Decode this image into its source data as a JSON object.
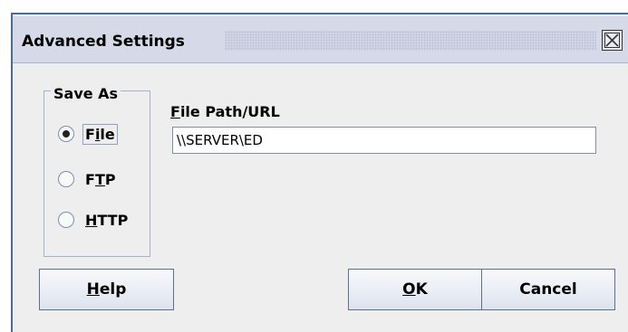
{
  "dialog": {
    "title": "Advanced Settings"
  },
  "save_as": {
    "legend": "Save As",
    "options": [
      {
        "pre": "F",
        "mnemonic": "i",
        "post": "le",
        "selected": true
      },
      {
        "pre": "F",
        "mnemonic": "T",
        "post": "P",
        "selected": false
      },
      {
        "pre": "",
        "mnemonic": "H",
        "post": "TTP",
        "selected": false
      }
    ]
  },
  "path": {
    "label_mnemonic": "F",
    "label_rest": "ile Path/URL",
    "value": "\\\\SERVER\\ED"
  },
  "buttons": {
    "help_mnemonic": "H",
    "help_rest": "elp",
    "ok_mnemonic": "O",
    "ok_rest": "K",
    "cancel": "Cancel"
  }
}
